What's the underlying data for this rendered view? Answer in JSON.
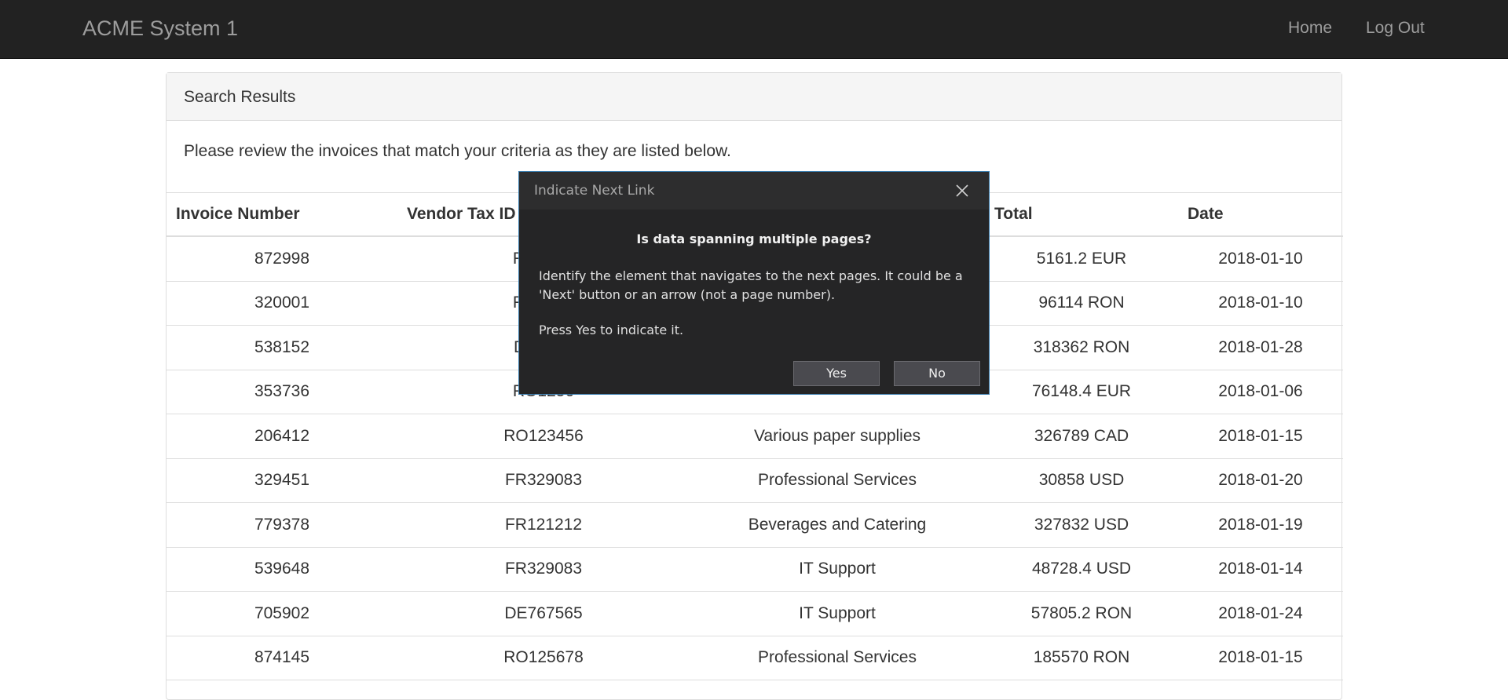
{
  "navbar": {
    "brand": "ACME System 1",
    "links": [
      "Home",
      "Log Out"
    ]
  },
  "panel": {
    "heading": "Search Results",
    "intro": "Please review the invoices that match your criteria as they are listed below."
  },
  "table": {
    "columns": [
      "Invoice Number",
      "Vendor Tax ID",
      "",
      "Total",
      "Date"
    ],
    "rows": [
      [
        "872998",
        "RO0947",
        "",
        "5161.2 EUR",
        "2018-01-10"
      ],
      [
        "320001",
        "RO3458",
        "",
        "96114 RON",
        "2018-01-10"
      ],
      [
        "538152",
        "DE4562",
        "",
        "318362 RON",
        "2018-01-28"
      ],
      [
        "353736",
        "RO1256",
        "",
        "76148.4 EUR",
        "2018-01-06"
      ],
      [
        "206412",
        "RO123456",
        "Various paper supplies",
        "326789 CAD",
        "2018-01-15"
      ],
      [
        "329451",
        "FR329083",
        "Professional Services",
        "30858 USD",
        "2018-01-20"
      ],
      [
        "779378",
        "FR121212",
        "Beverages and Catering",
        "327832 USD",
        "2018-01-19"
      ],
      [
        "539648",
        "FR329083",
        "IT Support",
        "48728.4 USD",
        "2018-01-14"
      ],
      [
        "705902",
        "DE767565",
        "IT Support",
        "57805.2 RON",
        "2018-01-24"
      ],
      [
        "874145",
        "RO125678",
        "Professional Services",
        "185570 RON",
        "2018-01-15"
      ]
    ]
  },
  "dialog": {
    "title": "Indicate Next Link",
    "close_icon": "close-icon",
    "heading": "Is data spanning multiple pages?",
    "text1": "Identify the element that navigates to the next pages. It could be a 'Next' button or an arrow (not a page number).",
    "text2": "Press Yes to indicate it.",
    "yes_label": "Yes",
    "no_label": "No"
  },
  "colors": {
    "navbar_bg": "#222222",
    "dialog_bg": "#252526",
    "dialog_border": "#3c7fb1"
  }
}
